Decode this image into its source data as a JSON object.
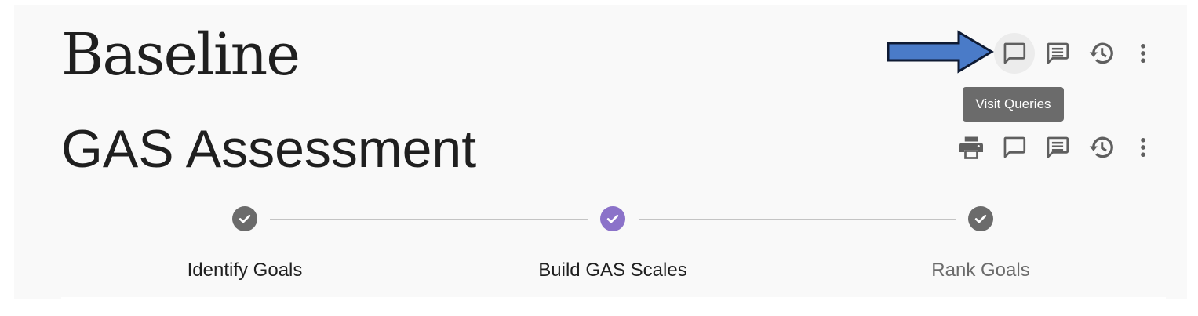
{
  "header": {
    "visit_title": "Baseline",
    "page_title": "GAS Assessment",
    "top_actions": [
      "chat-bubble-icon",
      "notes-icon",
      "history-icon",
      "more-vert-icon"
    ],
    "assessment_actions": [
      "print-icon",
      "chat-bubble-icon",
      "notes-icon",
      "history-icon",
      "more-vert-icon"
    ],
    "tooltip": "Visit Queries"
  },
  "stepper": {
    "steps": [
      {
        "label": "Identify Goals",
        "state": "complete",
        "color": "#6b6b6b"
      },
      {
        "label": "Build GAS Scales",
        "state": "active",
        "color": "#8b72c9"
      },
      {
        "label": "Rank Goals",
        "state": "complete",
        "color": "#6b6b6b"
      }
    ]
  },
  "colors": {
    "annotation_arrow": "#4a7bc8",
    "icon": "#5f5f5f",
    "tooltip_bg": "#6b6b6b"
  }
}
